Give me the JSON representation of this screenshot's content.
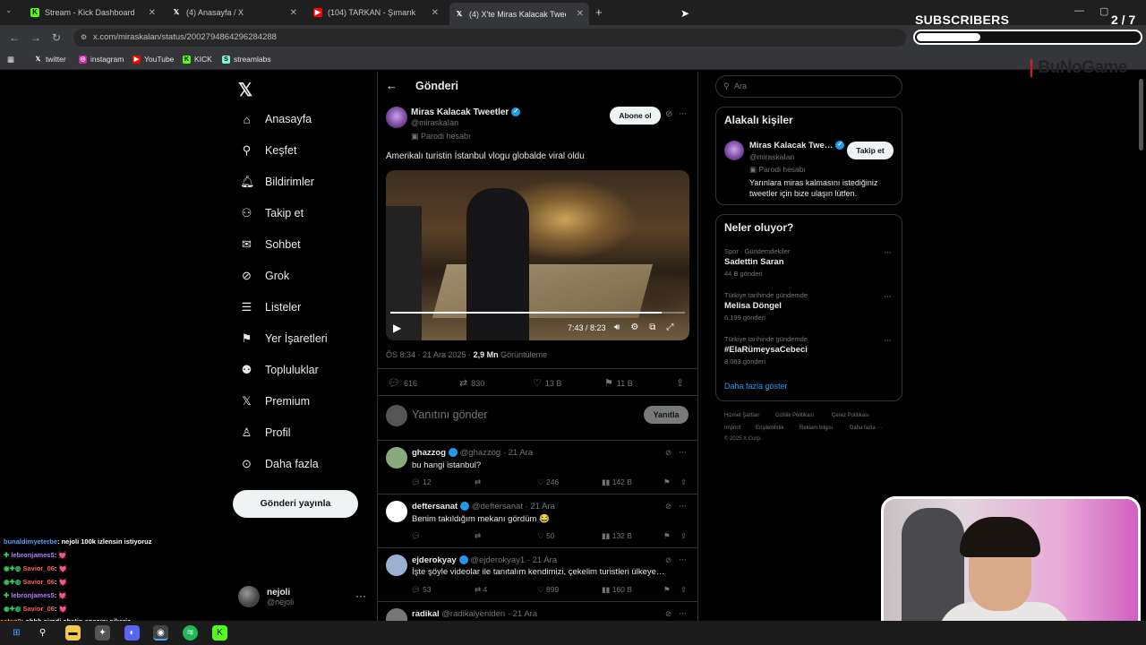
{
  "browser": {
    "tabs": [
      {
        "label": "Stream - Kick Dashboard",
        "icon": "kick-icon"
      },
      {
        "label": "(4) Anasayfa / X",
        "icon": "x-icon"
      },
      {
        "label": "(104) TARKAN - Şımarık (Of…",
        "icon": "youtube-icon"
      },
      {
        "label": "(4) X'te Miras Kalacak Tweetler…",
        "icon": "x-icon"
      }
    ],
    "url": "x.com/miraskalan/status/2002794864296284288",
    "bookmarks": [
      "twitter",
      "instagram",
      "YouTube",
      "KICK",
      "streamlabs"
    ]
  },
  "overlay": {
    "subscribers_label": "SUBSCRIBERS",
    "subscribers_count": "2 / 7",
    "subscribers_progress": 0.2857,
    "brand": "BuNoGame"
  },
  "nav": {
    "items": [
      "Anasayfa",
      "Keşfet",
      "Bildirimler",
      "Takip et",
      "Sohbet",
      "Grok",
      "Listeler",
      "Yer İşaretleri",
      "Topluluklar",
      "Premium",
      "Profil",
      "Daha fazla"
    ],
    "post_button": "Gönderi yayınla",
    "user_name": "nejoli",
    "user_handle": "@nejoli"
  },
  "post": {
    "header_title": "Gönderi",
    "author_name": "Miras Kalacak Tweetler",
    "author_handle": "@miraskaIan",
    "parody_label": "Parodi hesabı",
    "subscribe": "Abone ol",
    "text": "Amerikalı turistin İstanbul vlogu globalde viral oldu",
    "video_time": "7:43 / 8:23",
    "video_progress": 0.922,
    "meta_time": "ÖS 8:34 · 21 Ara 2025 · ",
    "views": "2,9 Mn",
    "views_label": " Görüntüleme",
    "stats": {
      "replies": "616",
      "reposts": "830",
      "likes": "13 B",
      "bookmarks": "11 B"
    },
    "reply_placeholder": "Yanıtını gönder",
    "reply_button": "Yanıtla"
  },
  "comments": [
    {
      "name": "ghazzog",
      "handle": "@ghazzog · 21 Ara",
      "text": "bu hangi istanbul?",
      "replies": "12",
      "reposts": "",
      "likes": "246",
      "views": "142 B"
    },
    {
      "name": "deftersanat",
      "handle": "@deftersanat · 21 Ara",
      "text": "Benim takıldığım mekanı gördüm 😂",
      "replies": "",
      "reposts": "",
      "likes": "50",
      "views": "132 B"
    },
    {
      "name": "ejderokyay",
      "handle": "@ejderokyay1 · 21 Ara",
      "text": "İşte şöyle videolar ile tanıtalım kendimizi, çekelim turistleri ülkeye…",
      "replies": "53",
      "reposts": "4",
      "likes": "899",
      "views": "160 B"
    },
    {
      "name": "radikal",
      "handle": "@radikalyeniden · 21 Ara",
      "text": "",
      "replies": "",
      "reposts": "",
      "likes": "",
      "views": ""
    }
  ],
  "sidebar": {
    "search_placeholder": "Ara",
    "related_title": "Alakalı kişiler",
    "related": {
      "name": "Miras Kalacak Twe…",
      "handle": "@miraskaIan",
      "parody": "Parodi hesabı",
      "bio": "Yarınlara miras kalmasını istediğiniz tweetler için bize ulaşın lütfen.",
      "follow": "Takip et"
    },
    "trends_title": "Neler oluyor?",
    "trends": [
      {
        "category": "Spor · Gündemdekiler",
        "name": "Sadettin Saran",
        "count": "44 B gönderi"
      },
      {
        "category": "Türkiye tarihinde gündemde",
        "name": "Melisa Döngel",
        "count": "6.199 gönderi"
      },
      {
        "category": "Türkiye tarihinde gündemde",
        "name": "#ElaRümeysaCebeci",
        "count": "8.063 gönderi"
      }
    ],
    "show_more": "Daha fazla göster",
    "footer": [
      "Hizmet Şartları",
      "Gizlilik Politikası",
      "Çerez Politikası",
      "Imprint",
      "Erişilebilirlik",
      "Reklam bilgisi",
      "Daha fazla ···",
      "© 2025 X Corp."
    ]
  },
  "chat": [
    {
      "user": "bunaldimyeterbe",
      "msg": ": nejoli 100k izlensin istiyoruz",
      "color": "#4aa3ff"
    },
    {
      "user": "lebronjames5",
      "msg": ": 💓",
      "color": "#b77cff"
    },
    {
      "user": "Savior_06",
      "msg": ": 💓",
      "color": "#ff5a5a"
    },
    {
      "user": "Savior_06",
      "msg": ": 💓",
      "color": "#ff5a5a"
    },
    {
      "user": "lebronjames5",
      "msg": ": 💓",
      "color": "#b77cff"
    },
    {
      "user": "Savior_06",
      "msg": ": 💓",
      "color": "#ff5a5a"
    },
    {
      "user": "asten9",
      "msg": ": ohhh şimdi chatin anasını sikeriz",
      "color": "#ff9f2e"
    }
  ]
}
